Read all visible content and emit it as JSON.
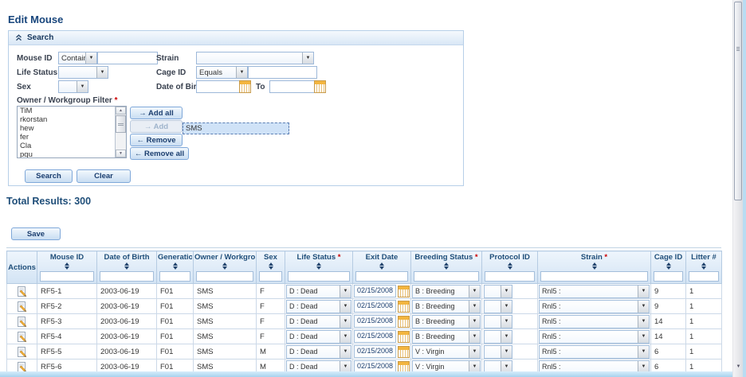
{
  "colors": {
    "accent": "#1f4e79",
    "required": "#cc0000",
    "selection": "#cfe2f7",
    "button_face": "#c9ddf2"
  },
  "page": {
    "title": "Edit Mouse"
  },
  "search": {
    "title": "Search",
    "mouse_id_label": "Mouse ID",
    "mouse_id_operator": "Contains",
    "mouse_id_value": "",
    "strain_label": "Strain",
    "strain_value": "",
    "life_status_label": "Life Status",
    "life_status_value": "",
    "cage_id_label": "Cage ID",
    "cage_id_operator": "Equals",
    "cage_id_value": "",
    "sex_label": "Sex",
    "sex_value": "",
    "dob_label": "Date of Birth",
    "dob_from": "",
    "dob_to_label": "To",
    "dob_to": "",
    "owner_filter_label": "Owner / Workgroup Filter",
    "required_mark": "*",
    "owner_options": [
      "TiM",
      "rkorstan",
      "hew",
      "fer",
      "Cla",
      "pqu"
    ],
    "selected_owner": "SMS",
    "add_all_label": "→ Add all",
    "add_label": "→ Add",
    "remove_label": "← Remove",
    "remove_all_label": "← Remove all",
    "search_button": "Search",
    "clear_button": "Clear"
  },
  "results": {
    "total_label": "Total Results: 300",
    "save_button": "Save",
    "columns": [
      {
        "label": "Actions",
        "required": false,
        "sortable": false,
        "filterable": false
      },
      {
        "label": "Mouse ID",
        "required": false,
        "sortable": true,
        "filterable": true
      },
      {
        "label": "Date of Birth",
        "required": false,
        "sortable": true,
        "filterable": true
      },
      {
        "label": "Generation",
        "required": false,
        "sortable": true,
        "filterable": true
      },
      {
        "label": "Owner / Workgroup",
        "required": false,
        "sortable": true,
        "filterable": true
      },
      {
        "label": "Sex",
        "required": false,
        "sortable": true,
        "filterable": true
      },
      {
        "label": "Life Status",
        "required": true,
        "sortable": true,
        "filterable": true
      },
      {
        "label": "Exit Date",
        "required": false,
        "sortable": true,
        "filterable": true
      },
      {
        "label": "Breeding Status",
        "required": true,
        "sortable": true,
        "filterable": true
      },
      {
        "label": "Protocol ID",
        "required": false,
        "sortable": true,
        "filterable": true
      },
      {
        "label": "Strain",
        "required": true,
        "sortable": true,
        "filterable": true
      },
      {
        "label": "Cage ID",
        "required": false,
        "sortable": true,
        "filterable": true
      },
      {
        "label": "Litter #",
        "required": false,
        "sortable": true,
        "filterable": true
      }
    ],
    "rows": [
      {
        "mouse_id": "RF5-1",
        "date_of_birth": "2003-06-19",
        "generation": "F01",
        "owner_workgroup": "SMS",
        "sex": "F",
        "life_status": "D : Dead",
        "exit_date": "02/15/2008",
        "breeding_status": "B : Breeding",
        "protocol_id": "",
        "strain": "Rnl5 :",
        "cage_id": "9",
        "litter": "1"
      },
      {
        "mouse_id": "RF5-2",
        "date_of_birth": "2003-06-19",
        "generation": "F01",
        "owner_workgroup": "SMS",
        "sex": "F",
        "life_status": "D : Dead",
        "exit_date": "02/15/2008",
        "breeding_status": "B : Breeding",
        "protocol_id": "",
        "strain": "Rnl5 :",
        "cage_id": "9",
        "litter": "1"
      },
      {
        "mouse_id": "RF5-3",
        "date_of_birth": "2003-06-19",
        "generation": "F01",
        "owner_workgroup": "SMS",
        "sex": "F",
        "life_status": "D : Dead",
        "exit_date": "02/15/2008",
        "breeding_status": "B : Breeding",
        "protocol_id": "",
        "strain": "Rnl5 :",
        "cage_id": "14",
        "litter": "1"
      },
      {
        "mouse_id": "RF5-4",
        "date_of_birth": "2003-06-19",
        "generation": "F01",
        "owner_workgroup": "SMS",
        "sex": "F",
        "life_status": "D : Dead",
        "exit_date": "02/15/2008",
        "breeding_status": "B : Breeding",
        "protocol_id": "",
        "strain": "Rnl5 :",
        "cage_id": "14",
        "litter": "1"
      },
      {
        "mouse_id": "RF5-5",
        "date_of_birth": "2003-06-19",
        "generation": "F01",
        "owner_workgroup": "SMS",
        "sex": "M",
        "life_status": "D : Dead",
        "exit_date": "02/15/2008",
        "breeding_status": "V : Virgin",
        "protocol_id": "",
        "strain": "Rnl5 :",
        "cage_id": "6",
        "litter": "1"
      },
      {
        "mouse_id": "RF5-6",
        "date_of_birth": "2003-06-19",
        "generation": "F01",
        "owner_workgroup": "SMS",
        "sex": "M",
        "life_status": "D : Dead",
        "exit_date": "02/15/2008",
        "breeding_status": "V : Virgin",
        "protocol_id": "",
        "strain": "Rnl5 :",
        "cage_id": "6",
        "litter": "1"
      }
    ]
  }
}
